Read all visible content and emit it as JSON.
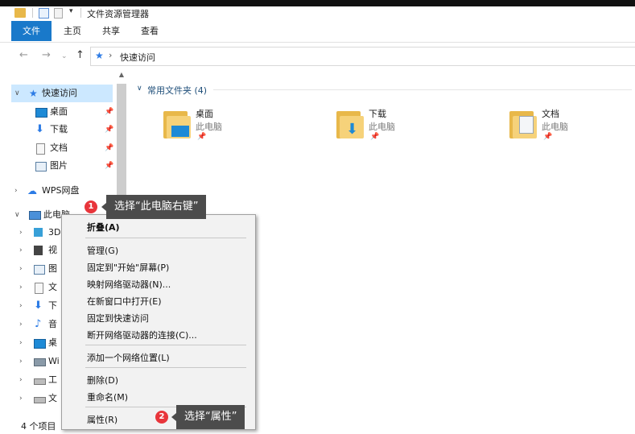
{
  "window": {
    "title": "文件资源管理器",
    "quick_access_toolbar": [
      "folder-icon",
      "check-icon",
      "doc-icon"
    ]
  },
  "ribbon": {
    "tabs": [
      {
        "label": "文件"
      },
      {
        "label": "主页"
      },
      {
        "label": "共享"
      },
      {
        "label": "查看"
      }
    ]
  },
  "address": {
    "back": "←",
    "forward": "→",
    "recent": "⌄",
    "up": "↑",
    "separator": "›",
    "path": "快速访问"
  },
  "nav_pane": {
    "quick_access": "快速访问",
    "pinned": [
      {
        "label": "桌面",
        "icon": "desktop-icon"
      },
      {
        "label": "下载",
        "icon": "download-icon"
      },
      {
        "label": "文档",
        "icon": "document-icon"
      },
      {
        "label": "图片",
        "icon": "picture-icon"
      }
    ],
    "wps": "WPS网盘",
    "this_pc": "此电脑",
    "pc_children": [
      {
        "label": "3D"
      },
      {
        "label": "视"
      },
      {
        "label": "图"
      },
      {
        "label": "文"
      },
      {
        "label": "下"
      },
      {
        "label": "音"
      },
      {
        "label": "桌"
      },
      {
        "label": "Wi"
      },
      {
        "label": "工"
      },
      {
        "label": "文"
      }
    ]
  },
  "content": {
    "group_header": "常用文件夹 (4)",
    "tiles": [
      {
        "name": "桌面",
        "location": "此电脑"
      },
      {
        "name": "下载",
        "location": "此电脑"
      },
      {
        "name": "文档",
        "location": "此电脑"
      }
    ]
  },
  "status_bar": {
    "count": "4 个项目"
  },
  "context_menu": {
    "items": [
      "折叠(A)",
      "管理(G)",
      "固定到\"开始\"屏幕(P)",
      "映射网络驱动器(N)...",
      "在新窗口中打开(E)",
      "固定到快速访问",
      "断开网络驱动器的连接(C)...",
      "添加一个网络位置(L)",
      "删除(D)",
      "重命名(M)",
      "属性(R)"
    ]
  },
  "callouts": [
    {
      "number": "1",
      "text": "选择“此电脑右键”"
    },
    {
      "number": "2",
      "text": "选择“属性”"
    }
  ],
  "colors": {
    "accent": "#1979ca",
    "selection": "#cce8ff",
    "badge": "#e8353b",
    "callout": "#4c4c4c"
  }
}
